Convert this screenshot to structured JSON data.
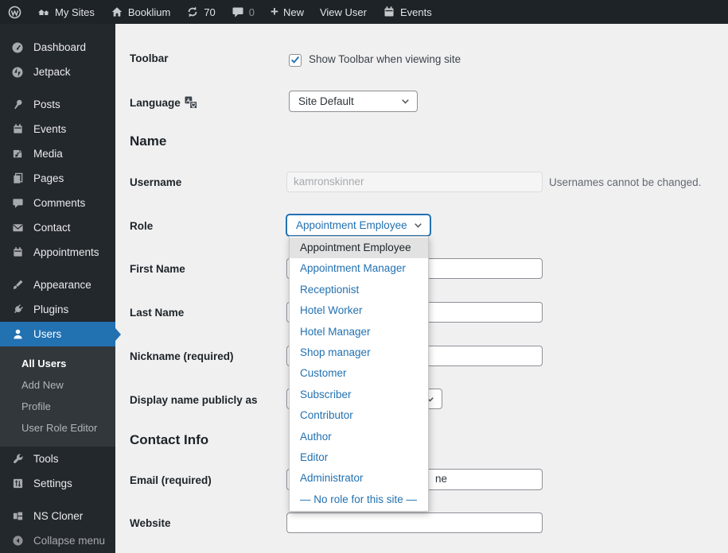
{
  "colors": {
    "accent": "#2271b1",
    "admin_bar_bg": "#1d2327",
    "sidebar_bg": "#23282d",
    "submenu_bg": "#32373c",
    "content_bg": "#f0f0f1",
    "link_blue": "#2271b1",
    "selected_option_bg": "#e2e2e2"
  },
  "admin_bar": {
    "my_sites": "My Sites",
    "site_name": "Booklium",
    "updates_count": "70",
    "comments_count": "0",
    "new_label": "New",
    "view_user_label": "View User",
    "events_label": "Events"
  },
  "sidebar": {
    "items": [
      {
        "label": "Dashboard"
      },
      {
        "label": "Jetpack"
      },
      {
        "label": "Posts"
      },
      {
        "label": "Events"
      },
      {
        "label": "Media"
      },
      {
        "label": "Pages"
      },
      {
        "label": "Comments"
      },
      {
        "label": "Contact"
      },
      {
        "label": "Appointments"
      },
      {
        "label": "Appearance"
      },
      {
        "label": "Plugins"
      },
      {
        "label": "Users"
      },
      {
        "label": "Tools"
      },
      {
        "label": "Settings"
      },
      {
        "label": "NS Cloner"
      },
      {
        "label": "Collapse menu"
      }
    ],
    "users_submenu": [
      {
        "label": "All Users"
      },
      {
        "label": "Add New"
      },
      {
        "label": "Profile"
      },
      {
        "label": "User Role Editor"
      }
    ]
  },
  "main": {
    "toolbar_label": "Toolbar",
    "toolbar_checkbox_label": "Show Toolbar when viewing site",
    "toolbar_checked": true,
    "language_label": "Language",
    "language_value": "Site Default",
    "name_heading": "Name",
    "username_label": "Username",
    "username_value": "kamronskinner",
    "username_description": "Usernames cannot be changed.",
    "role_label": "Role",
    "role_value": "Appointment Employee",
    "role_options": [
      "Appointment Employee",
      "Appointment Manager",
      "Receptionist",
      "Hotel Worker",
      "Hotel Manager",
      "Shop manager",
      "Customer",
      "Subscriber",
      "Contributor",
      "Author",
      "Editor",
      "Administrator",
      "— No role for this site —"
    ],
    "first_name_label": "First Name",
    "first_name_value": "",
    "last_name_label": "Last Name",
    "last_name_value": "",
    "nickname_label": "Nickname (required)",
    "nickname_value": "",
    "display_name_label": "Display name publicly as",
    "contact_heading": "Contact Info",
    "email_label": "Email (required)",
    "email_visible_fragment": "ne",
    "website_label": "Website",
    "website_value": ""
  }
}
